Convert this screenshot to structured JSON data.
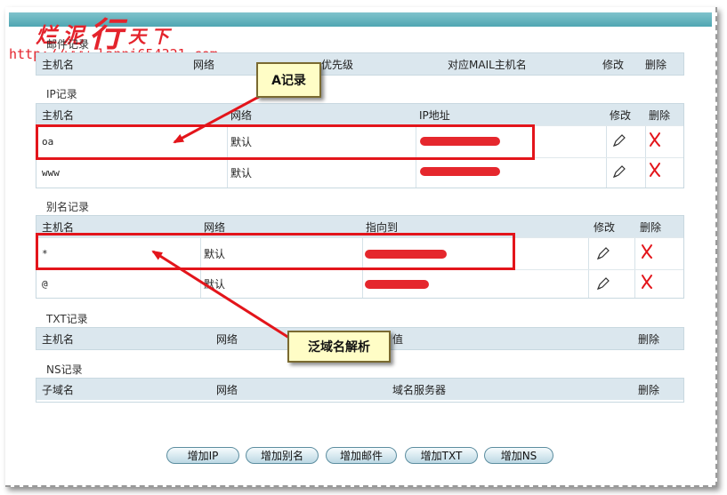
{
  "watermark": {
    "title_part1": "烂泥",
    "title_big": "行",
    "title_part2": "天下",
    "url": "http://www.lanni654321.com"
  },
  "sections": {
    "mail": {
      "label": "邮件记录",
      "headers": [
        "主机名",
        "网络",
        "优先级",
        "对应MAIL主机名",
        "修改",
        "删除"
      ]
    },
    "ip": {
      "label": "IP记录",
      "headers": [
        "主机名",
        "网络",
        "IP地址",
        "修改",
        "删除"
      ],
      "rows": [
        {
          "host": "oa",
          "network": "默认"
        },
        {
          "host": "www",
          "network": "默认"
        }
      ]
    },
    "alias": {
      "label": "别名记录",
      "headers": [
        "主机名",
        "网络",
        "指向到",
        "修改",
        "删除"
      ],
      "rows": [
        {
          "host": "*",
          "network": "默认"
        },
        {
          "host": "@",
          "network": "默认"
        }
      ]
    },
    "txt": {
      "label": "TXT记录",
      "headers": [
        "主机名",
        "网络",
        "值",
        "删除"
      ]
    },
    "ns": {
      "label": "NS记录",
      "headers": [
        "子域名",
        "网络",
        "域名服务器",
        "删除"
      ]
    }
  },
  "callouts": {
    "a_record": "A记录",
    "wildcard": "泛域名解析"
  },
  "buttons": [
    "增加IP",
    "增加别名",
    "增加邮件",
    "增加TXT",
    "增加NS"
  ],
  "colors": {
    "header_bg": "#dbe7ee",
    "topbar": "#4fa6b2",
    "annotation_red": "#e3151b",
    "callout_bg": "#fffdc6"
  }
}
